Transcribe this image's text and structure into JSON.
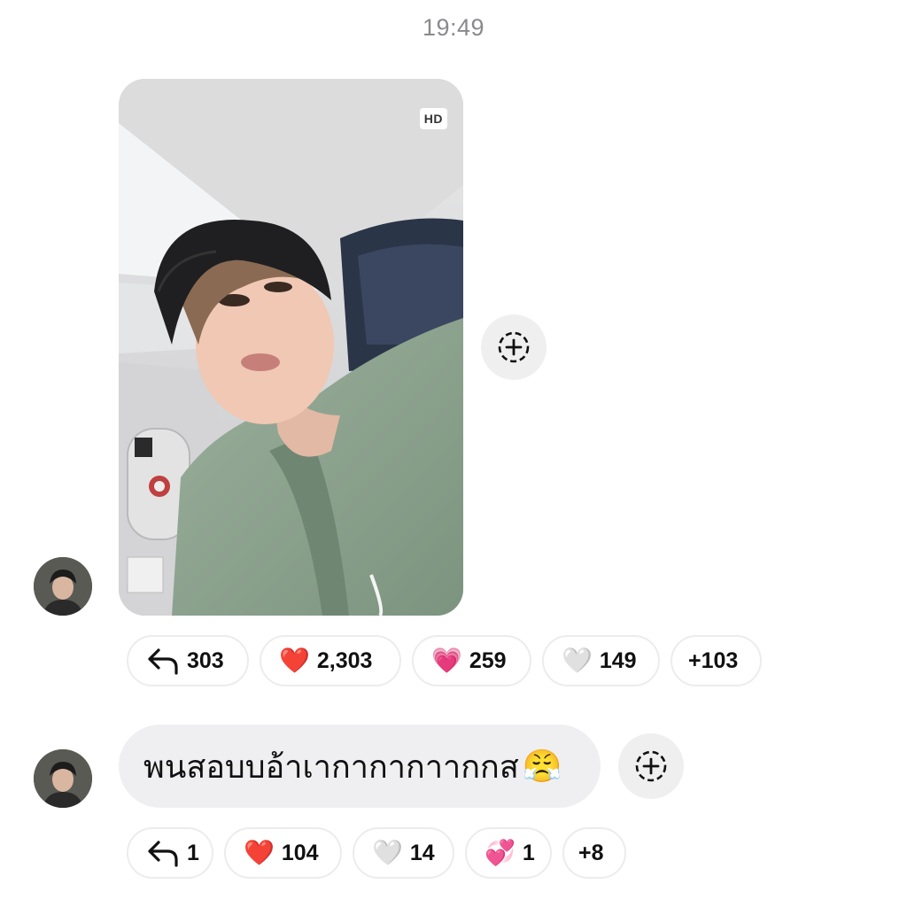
{
  "timestamp": "19:49",
  "photo_message": {
    "badge": "HD",
    "reactions": [
      {
        "icon": "reply-arrow-icon",
        "count": "303"
      },
      {
        "icon": "red-heart-icon",
        "glyph": "❤️",
        "count": "2,303"
      },
      {
        "icon": "pink-heart-icon",
        "glyph": "💗",
        "count": "259"
      },
      {
        "icon": "white-heart-icon",
        "glyph": "🤍",
        "count": "149"
      },
      {
        "icon": "",
        "count": "+103"
      }
    ]
  },
  "text_message": {
    "text": "พนสอบบอ้าเากากากาากกส",
    "emoji": "😤",
    "reactions": [
      {
        "icon": "reply-arrow-icon",
        "count": "1"
      },
      {
        "icon": "red-heart-icon",
        "glyph": "❤️",
        "count": "104"
      },
      {
        "icon": "white-heart-icon",
        "glyph": "🤍",
        "count": "14"
      },
      {
        "icon": "heart-with-ribbon-icon",
        "glyph": "💞",
        "count": "1"
      },
      {
        "icon": "",
        "count": "+8"
      }
    ]
  },
  "colors": {
    "bubble": "#efeff1",
    "timestamp": "#8a8a8e",
    "chip_border": "#ececee"
  }
}
